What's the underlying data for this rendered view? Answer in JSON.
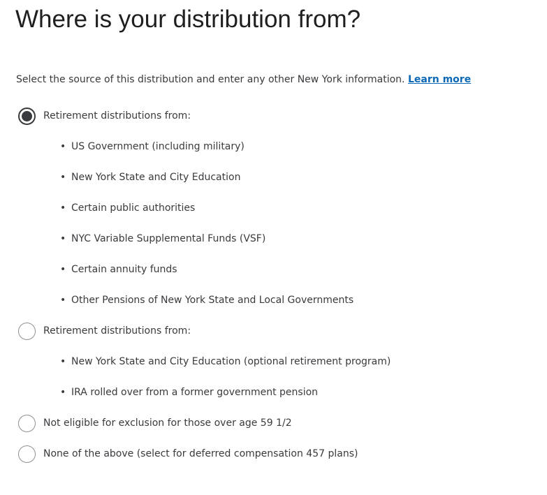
{
  "page": {
    "title": "Where is your distribution from?",
    "intro_text": "Select the source of this distribution and enter any other New York information.",
    "learn_more_label": "Learn more"
  },
  "options": [
    {
      "label": "Retirement distributions from:",
      "selected": true,
      "bullets": [
        "US Government (including military)",
        "New York State and City Education",
        "Certain public authorities",
        "NYC Variable Supplemental Funds (VSF)",
        "Certain annuity funds",
        "Other Pensions of New York State and Local Governments"
      ]
    },
    {
      "label": "Retirement distributions from:",
      "selected": false,
      "bullets": [
        "New York State and City Education (optional retirement program)",
        "IRA rolled over from a former government pension"
      ]
    },
    {
      "label": "Not eligible for exclusion for those over age 59 1/2",
      "selected": false,
      "bullets": []
    },
    {
      "label": "None of the above (select for deferred compensation 457 plans)",
      "selected": false,
      "bullets": []
    }
  ],
  "bullet_glyph": "•",
  "colors": {
    "text": "#393a3d",
    "title": "#1f1f20",
    "link": "#0d68b5",
    "radio_border": "#8d9096",
    "radio_selected": "#393a3d"
  }
}
